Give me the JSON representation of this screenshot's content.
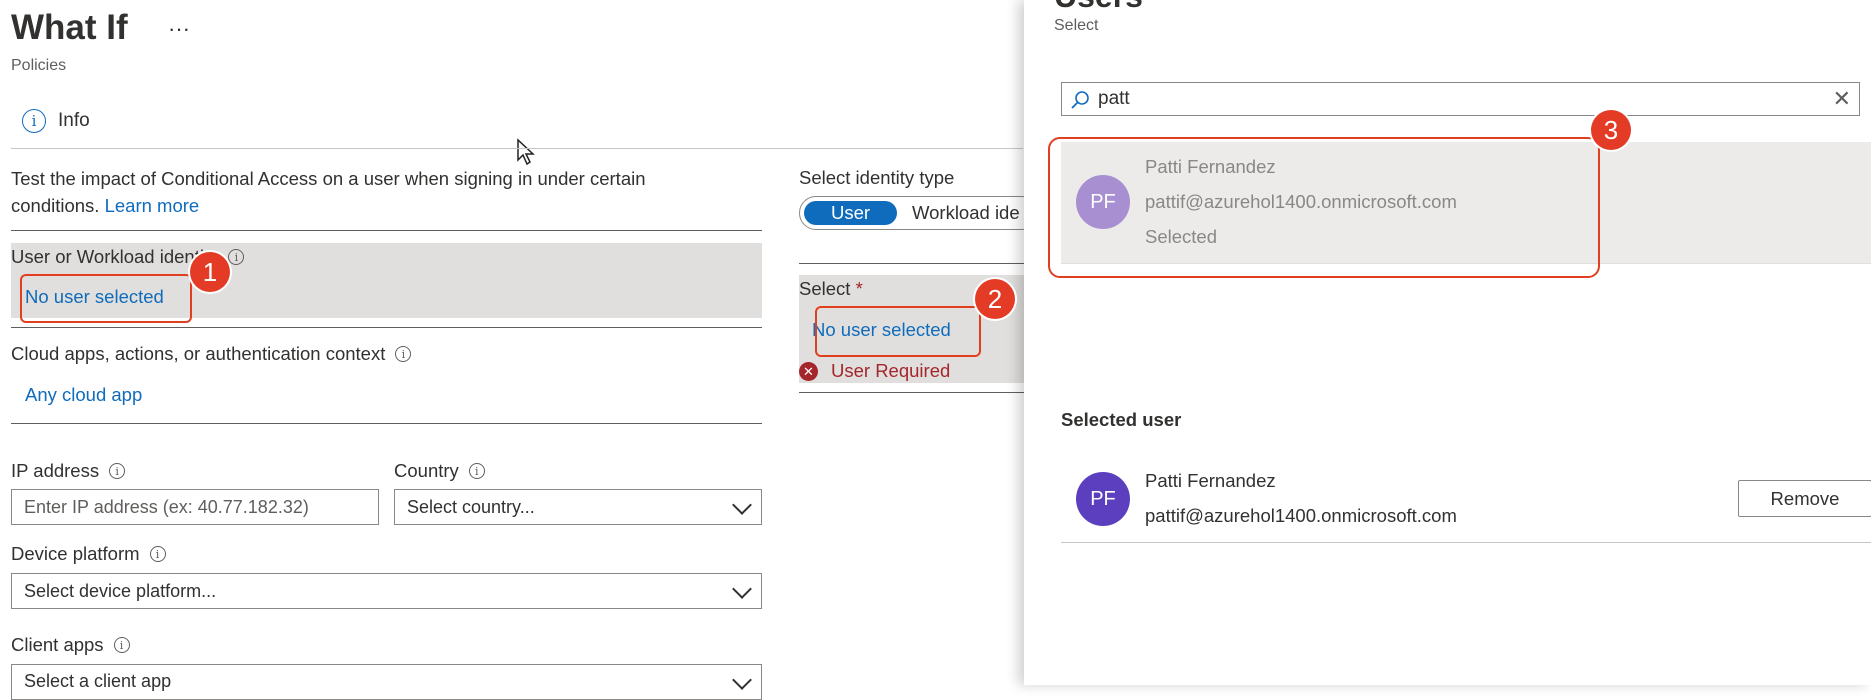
{
  "header": {
    "title": "What If",
    "more": "···",
    "breadcrumb": "Policies",
    "info_label": "Info"
  },
  "intro": {
    "text": "Test the impact of Conditional Access on a user when signing in under certain conditions.",
    "learn_more": "Learn more"
  },
  "identity": {
    "label": "User or Workload identity",
    "value": "No user selected"
  },
  "apps": {
    "label": "Cloud apps, actions, or authentication context",
    "value": "Any cloud app"
  },
  "ip": {
    "label": "IP address",
    "placeholder": "Enter IP address (ex: 40.77.182.32)"
  },
  "country": {
    "label": "Country",
    "value": "Select country..."
  },
  "device": {
    "label": "Device platform",
    "value": "Select device platform..."
  },
  "client": {
    "label": "Client apps",
    "value": "Select a client app"
  },
  "middle": {
    "identity_type_label": "Select identity type",
    "toggle_user": "User",
    "toggle_workload": "Workload ide",
    "select_label": "Select",
    "required_mark": "*",
    "select_value": "No user selected",
    "error": "User Required"
  },
  "panel": {
    "title": "Users",
    "subtitle": "Select",
    "search_value": "patt",
    "result": {
      "initials": "PF",
      "name": "Patti Fernandez",
      "email": "pattif@azurehol1400.onmicrosoft.com",
      "status": "Selected"
    },
    "selected_heading": "Selected user",
    "selected": {
      "initials": "PF",
      "name": "Patti Fernandez",
      "email": "pattif@azurehol1400.onmicrosoft.com",
      "remove_label": "Remove"
    }
  },
  "annotations": [
    "1",
    "2",
    "3"
  ],
  "colors": {
    "link": "#0f6cbd",
    "annotation_red": "#e33b26",
    "error_red": "#a4262c",
    "avatar_light": "#a78fd2",
    "avatar_dark": "#5b3fbf",
    "toggle_active": "#0f6cbd"
  }
}
